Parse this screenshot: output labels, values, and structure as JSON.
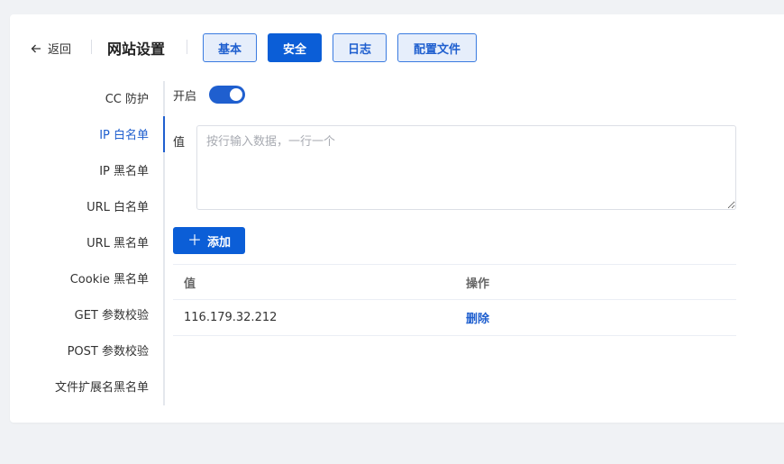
{
  "header": {
    "back_label": "返回",
    "title": "网站设置",
    "tabs": [
      {
        "label": "基本",
        "active": false
      },
      {
        "label": "安全",
        "active": true
      },
      {
        "label": "日志",
        "active": false
      },
      {
        "label": "配置文件",
        "active": false
      }
    ]
  },
  "sidebar": {
    "items": [
      {
        "label": "CC 防护"
      },
      {
        "label": "IP 白名单",
        "active": true
      },
      {
        "label": "IP 黑名单"
      },
      {
        "label": "URL 白名单"
      },
      {
        "label": "URL 黑名单"
      },
      {
        "label": "Cookie 黑名单"
      },
      {
        "label": "GET 参数校验"
      },
      {
        "label": "POST 参数校验"
      },
      {
        "label": "文件扩展名黑名单"
      }
    ]
  },
  "form": {
    "enable_label": "开启",
    "enabled": true,
    "value_label": "值",
    "value_placeholder": "按行输入数据，一行一个",
    "value": "",
    "add_button": "添加"
  },
  "table": {
    "columns": [
      "值",
      "操作"
    ],
    "rows": [
      {
        "value": "116.179.32.212",
        "action": "删除"
      }
    ]
  },
  "colors": {
    "accent": "#0b5ed7",
    "link": "#1f5fcf",
    "tab_bg": "#e6eefb",
    "page_bg": "#f0f2f5"
  }
}
